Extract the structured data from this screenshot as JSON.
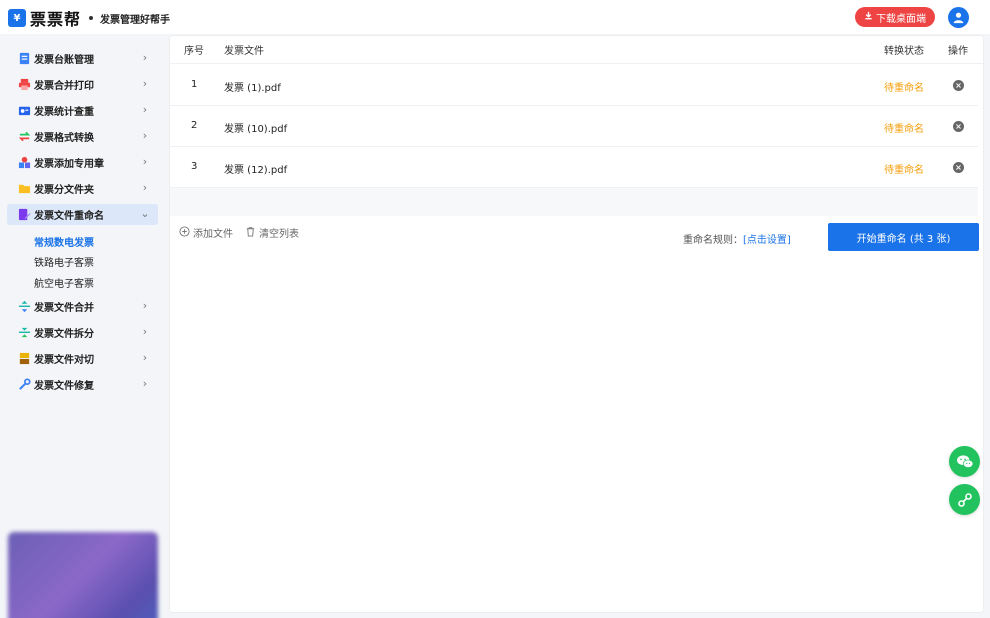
{
  "header": {
    "logo_mark": "¥",
    "app_name": "票票帮",
    "slogan": "发票管理好帮手",
    "download_label": "下载桌面端",
    "colors": {
      "brand": "#1a73e8",
      "download": "#ef4444"
    }
  },
  "sidebar": {
    "items": [
      {
        "label": "发票台账管理",
        "icon": "ledger-icon"
      },
      {
        "label": "发票合并打印",
        "icon": "printer-icon"
      },
      {
        "label": "发票统计查重",
        "icon": "stats-icon"
      },
      {
        "label": "发票格式转换",
        "icon": "convert-icon"
      },
      {
        "label": "发票添加专用章",
        "icon": "stamp-icon"
      },
      {
        "label": "发票分文件夹",
        "icon": "folder-icon"
      },
      {
        "label": "发票文件重命名",
        "icon": "rename-icon",
        "active": true
      },
      {
        "label": "发票文件合并",
        "icon": "merge-icon"
      },
      {
        "label": "发票文件拆分",
        "icon": "split-icon"
      },
      {
        "label": "发票文件对切",
        "icon": "cut-icon"
      },
      {
        "label": "发票文件修复",
        "icon": "repair-icon"
      }
    ],
    "sub_items": [
      {
        "label": "常规数电发票",
        "active": true
      },
      {
        "label": "铁路电子客票"
      },
      {
        "label": "航空电子客票"
      }
    ]
  },
  "table": {
    "headers": {
      "index": "序号",
      "file": "发票文件",
      "status": "转换状态",
      "action": "操作"
    },
    "rows": [
      {
        "index": "1",
        "file": "发票 (1).pdf",
        "status": "待重命名"
      },
      {
        "index": "2",
        "file": "发票 (10).pdf",
        "status": "待重命名"
      },
      {
        "index": "3",
        "file": "发票 (12).pdf",
        "status": "待重命名"
      }
    ],
    "status_color": "#f59e0b"
  },
  "toolbar": {
    "add_file": "添加文件",
    "clear_list": "清空列表",
    "rule_label": "重命名规则：",
    "rule_link": "[点击设置]",
    "start_button": "开始重命名 (共 3 张)"
  },
  "floating": {
    "wechat_icon": "wechat-icon",
    "link_icon": "link-icon",
    "color": "#22c35e"
  }
}
